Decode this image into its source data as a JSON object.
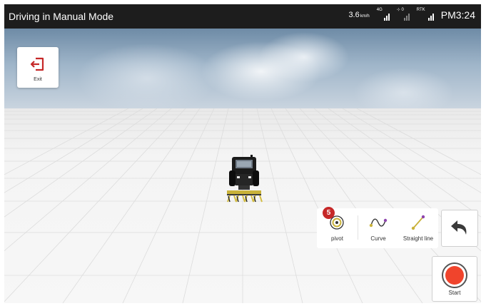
{
  "header": {
    "title": "Driving in Manual Mode",
    "speed_value": "3.6",
    "speed_unit": "km/h",
    "signal_4g_label": "4G",
    "signal_satellite_label": "⊹ 0",
    "signal_rtk_label": "RTK",
    "time": "PM3:24"
  },
  "exit": {
    "label": "Exit",
    "icon": "exit-icon"
  },
  "tools": {
    "pivot": {
      "label": "pivot",
      "badge": "5",
      "icon": "pivot-icon"
    },
    "curve": {
      "label": "Curve",
      "icon": "curve-icon"
    },
    "straight": {
      "label": "Straight line",
      "icon": "straight-line-icon"
    }
  },
  "back_button": {
    "icon": "back-arrow-icon"
  },
  "start": {
    "label": "Start",
    "icon": "record-icon"
  },
  "colors": {
    "statusbar": "#1d1d1d",
    "accent_red": "#c62828",
    "record_red": "#f0442c",
    "curve_line": "#b6a52a",
    "curve_dot": "#8e44ad"
  }
}
